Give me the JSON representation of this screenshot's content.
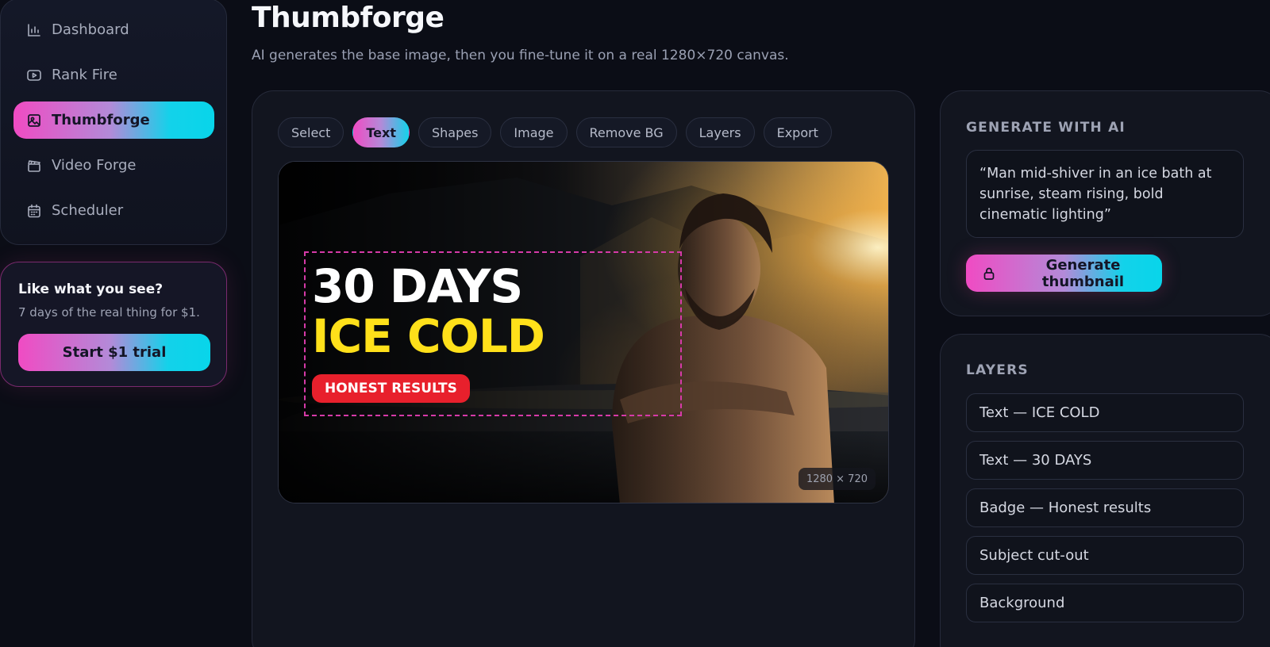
{
  "sidebar": {
    "items": [
      {
        "label": "Dashboard",
        "icon": "bar-chart-icon"
      },
      {
        "label": "Rank Fire",
        "icon": "video-play-icon"
      },
      {
        "label": "Thumbforge",
        "icon": "image-icon",
        "active": true
      },
      {
        "label": "Video Forge",
        "icon": "clapperboard-icon"
      },
      {
        "label": "Scheduler",
        "icon": "calendar-icon"
      }
    ],
    "trial": {
      "title": "Like what you see?",
      "subtitle": "7 days of the real thing for $1.",
      "button": "Start $1 trial"
    }
  },
  "header": {
    "title": "Thumbforge",
    "subtitle": "AI generates the base image, then you fine-tune it on a real 1280×720 canvas."
  },
  "editor": {
    "tools": [
      "Select",
      "Text",
      "Shapes",
      "Image",
      "Remove BG",
      "Layers",
      "Export"
    ],
    "active_tool": "Text",
    "canvas": {
      "line1": "30 DAYS",
      "line2": "ICE COLD",
      "badge": "HONEST RESULTS",
      "dimensions": "1280 × 720"
    }
  },
  "generate": {
    "label": "GENERATE WITH AI",
    "prompt": "“Man mid-shiver in an ice bath at sunrise, steam rising, bold cinematic lighting”",
    "button": "Generate thumbnail",
    "button_icon": "lock-icon"
  },
  "layers": {
    "label": "LAYERS",
    "items": [
      "Text — ICE COLD",
      "Text — 30 DAYS",
      "Badge — Honest results",
      "Subject cut-out",
      "Background"
    ]
  },
  "colors": {
    "accent_gradient": [
      "#f04bc3",
      "#13d2ea"
    ],
    "headline_yellow": "#ffe01a",
    "badge_red": "#e8202c",
    "selection_dash": "#d63aa8"
  }
}
